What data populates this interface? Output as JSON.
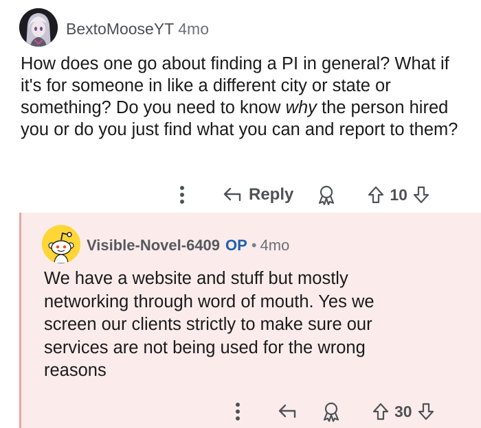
{
  "top_comment": {
    "avatar_icon": "anime-character-avatar",
    "username": "BextoMooseYT",
    "age": "4mo",
    "body_parts": [
      "How does one go about finding a PI in general? What if it's for someone in like a different city or state or something? Do you need to know ",
      "why",
      " the person hired you or do you just find what you can and report to them?"
    ],
    "actions": {
      "more_icon": "vertical-ellipsis-icon",
      "reply_label": "Reply",
      "award_icon": "award-icon",
      "upvote_icon": "upvote-arrow-icon",
      "vote_count": "10",
      "downvote_icon": "downvote-arrow-icon"
    }
  },
  "reply_comment": {
    "avatar_icon": "snoo-avatar",
    "username": "Visible-Novel-6409",
    "op_badge": "OP",
    "separator": "•",
    "age": "4mo",
    "body": "We have a website and stuff but mostly networking through word of mouth. Yes we screen our clients strictly to make sure our services are not being used for the wrong reasons",
    "highlight_color": "#fbeceb",
    "actions": {
      "more_icon": "vertical-ellipsis-icon",
      "reply_icon": "reply-arrow-icon",
      "award_icon": "award-icon",
      "upvote_icon": "upvote-arrow-icon",
      "vote_count": "30",
      "downvote_icon": "downvote-arrow-icon"
    }
  }
}
